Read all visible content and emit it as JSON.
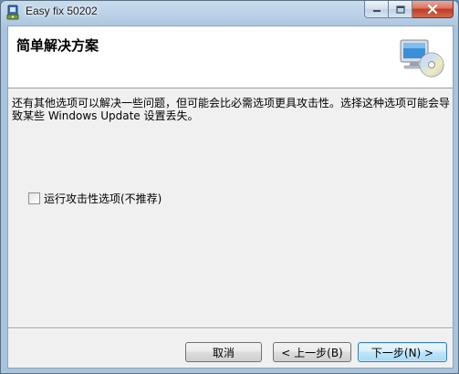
{
  "window": {
    "title": "Easy fix 50202",
    "icon": "troubleshooter-app-icon"
  },
  "caption_buttons": {
    "minimize_icon": "minimize-icon",
    "maximize_icon": "maximize-icon",
    "close_icon": "close-icon"
  },
  "header": {
    "title": "简单解决方案",
    "icon": "computer-cd-icon"
  },
  "description": "还有其他选项可以解决一些问题，但可能会比必需选项更具攻击性。选择这种选项可能会导致某些 Windows Update 设置丢失。",
  "option": {
    "label": "运行攻击性选项(不推荐)",
    "checked": false
  },
  "buttons": {
    "cancel": "取消",
    "back": "< 上一步(B)",
    "next": "下一步(N) >"
  },
  "colors": {
    "accent": "#3c7fb1",
    "close_button": "#c13a22"
  }
}
